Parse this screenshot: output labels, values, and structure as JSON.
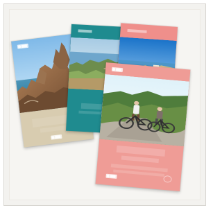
{
  "image": {
    "description_icon": "brochure-collection-icon",
    "accent_colors": {
      "beige": "#d8ccb0",
      "teal": "#1f8b8f",
      "coral": "#ef9c96"
    }
  },
  "brochures": {
    "back_left": {
      "icon": "cliff-brochure-icon"
    },
    "back_middle": {
      "icon": "coast-brochure-icon"
    },
    "back_right": {
      "icon": "harbour-brochure-icon"
    },
    "front": {
      "icon": "cycling-brochure-icon"
    }
  }
}
